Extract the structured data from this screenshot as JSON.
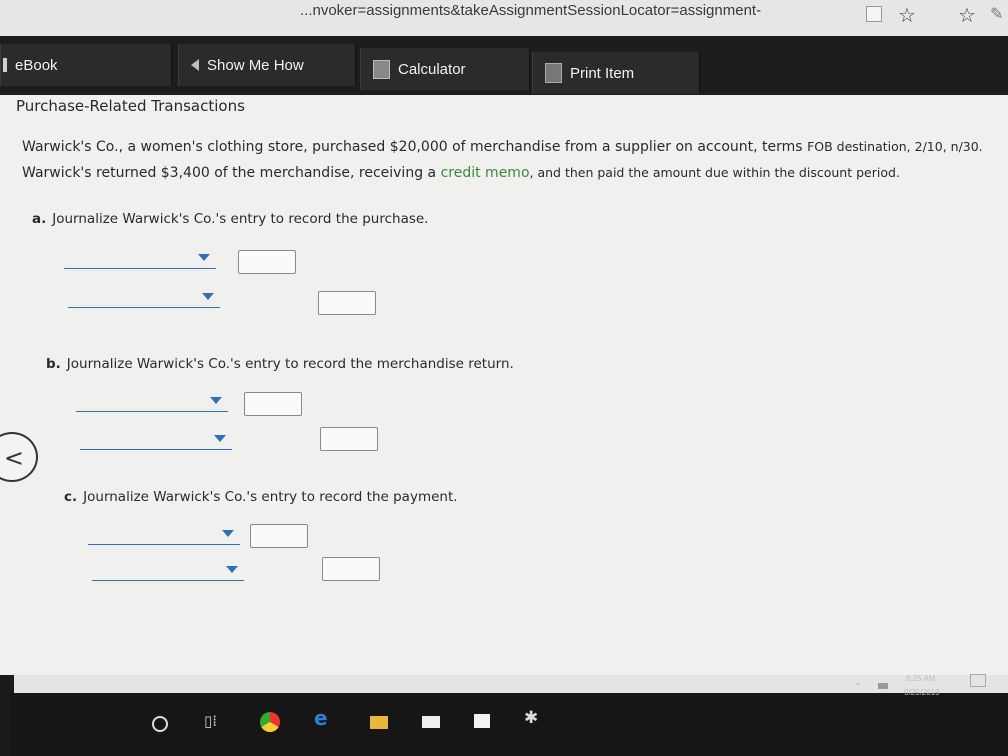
{
  "browser": {
    "url_fragment": "...nvoker=assignments&takeAssignmentSessionLocator=assignment-"
  },
  "toolbar": {
    "ebook_label": "eBook",
    "show_me_how_label": "Show Me How",
    "calculator_label": "Calculator",
    "print_item_label": "Print Item"
  },
  "problem": {
    "title": "Purchase-Related Transactions",
    "line1_main": "Warwick's Co., a women's clothing store, purchased $20,000 of merchandise from a supplier on account, terms ",
    "line1_terms": "FOB destination, 2/10, n/30.",
    "line2_a": "Warwick's returned $3,400 of the merchandise, receiving a ",
    "line2_link": "credit memo",
    "line2_b": ", and then paid the amount due within the discount period."
  },
  "questions": {
    "a_letter": "a.",
    "a_text": "Journalize Warwick's Co.'s entry to record the purchase.",
    "b_letter": "b.",
    "b_text": "Journalize Warwick's Co.'s entry to record the merchandise return.",
    "c_letter": "c.",
    "c_text": "Journalize Warwick's Co.'s entry to record the payment."
  },
  "taskbar": {
    "time": "8:25 AM",
    "date": "9/29/2019"
  },
  "icons": {
    "back": "back-chevron-icon",
    "star": "star-icon",
    "favorites": "favorites-icon"
  },
  "colors": {
    "accent_blue": "#2f6fb8",
    "link_green": "#3a8a3a",
    "toolbar_bg": "#1d1d1d"
  }
}
